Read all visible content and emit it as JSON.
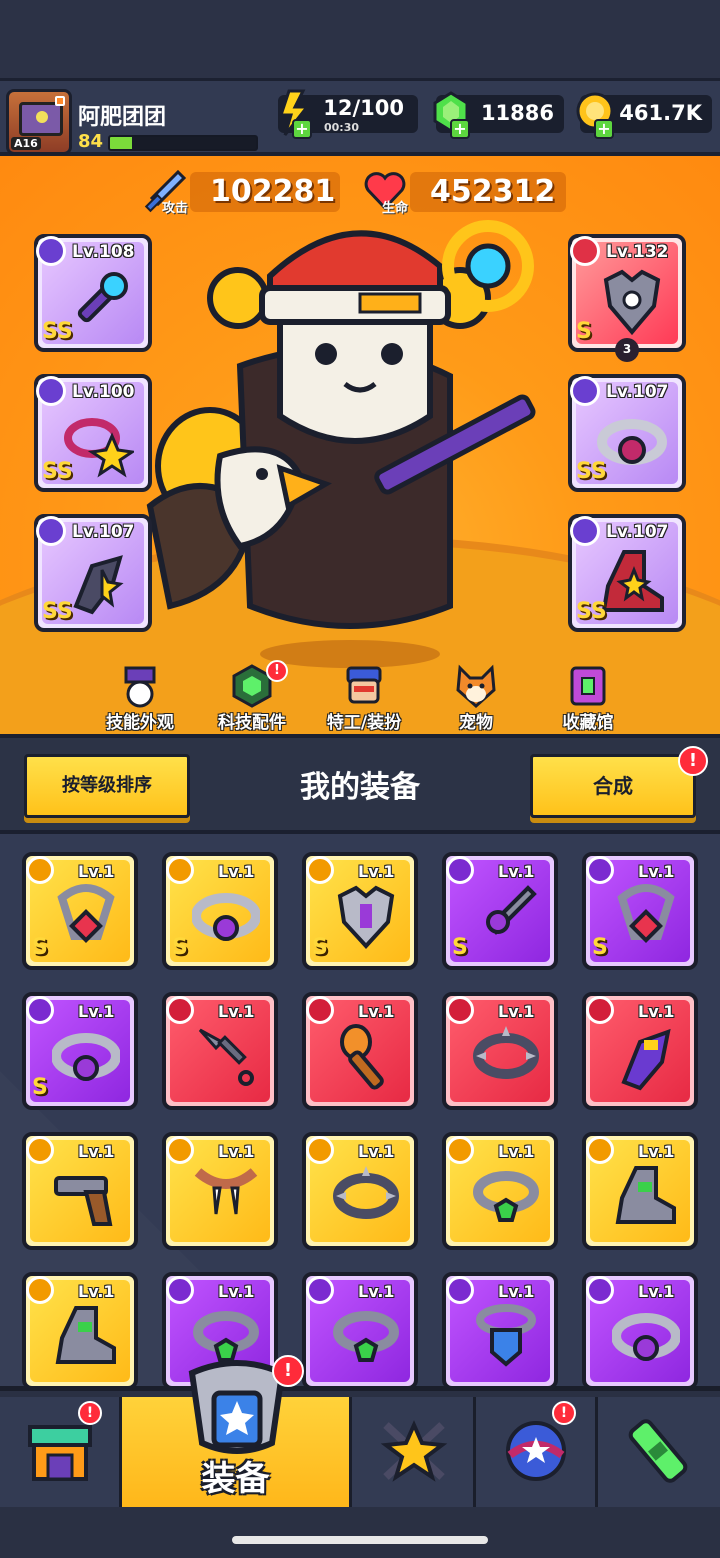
{
  "player": {
    "name": "阿肥团团",
    "level": "84",
    "avatar_tag": "A16",
    "xp_progress": 0.15
  },
  "resources": {
    "energy": {
      "value": "12/100",
      "timer": "00:30"
    },
    "gems": {
      "value": "11886"
    },
    "gold": {
      "value": "461.7K"
    }
  },
  "stats": {
    "attack": {
      "label": "攻击",
      "value": "102281"
    },
    "hp": {
      "label": "生命",
      "value": "452312"
    }
  },
  "equipped": {
    "left": [
      {
        "level": "Lv.108",
        "grade": "SS",
        "rarity": "purple",
        "icon": "staff-icon",
        "type_icon": "weapon-type-icon"
      },
      {
        "level": "Lv.100",
        "grade": "SS",
        "rarity": "purple",
        "icon": "star-necklace-icon",
        "type_icon": "necklace-type-icon"
      },
      {
        "level": "Lv.107",
        "grade": "SS",
        "rarity": "purple",
        "icon": "gauntlet-icon",
        "type_icon": "glove-type-icon"
      }
    ],
    "right": [
      {
        "level": "Lv.132",
        "grade": "S",
        "rarity": "red",
        "icon": "armor-icon",
        "type_icon": "armor-type-icon",
        "stars": "3"
      },
      {
        "level": "Lv.107",
        "grade": "SS",
        "rarity": "purple",
        "icon": "belt-icon",
        "type_icon": "belt-type-icon"
      },
      {
        "level": "Lv.107",
        "grade": "SS",
        "rarity": "purple",
        "icon": "boots-icon",
        "type_icon": "boots-type-icon"
      }
    ]
  },
  "menu": [
    {
      "label": "技能外观",
      "icon": "skill-skin-icon",
      "badge": ""
    },
    {
      "label": "科技配件",
      "icon": "tech-part-icon",
      "badge": "!"
    },
    {
      "label": "特工/装扮",
      "icon": "agent-icon",
      "badge": ""
    },
    {
      "label": "宠物",
      "icon": "pet-icon",
      "badge": ""
    },
    {
      "label": "收藏馆",
      "icon": "collection-icon",
      "badge": ""
    }
  ],
  "equipment_panel": {
    "sort_button": "按等级排序",
    "title": "我的装备",
    "synth_button": "合成",
    "synth_badge": "!"
  },
  "inventory": [
    {
      "level": "Lv.1",
      "rarity": "yellow",
      "grade": "S",
      "icon": "necklace-icon"
    },
    {
      "level": "Lv.1",
      "rarity": "yellow",
      "grade": "S",
      "icon": "belt-icon"
    },
    {
      "level": "Lv.1",
      "rarity": "yellow",
      "grade": "S",
      "icon": "armor-icon"
    },
    {
      "level": "Lv.1",
      "rarity": "purple",
      "grade": "S",
      "icon": "sword-icon"
    },
    {
      "level": "Lv.1",
      "rarity": "purple",
      "grade": "S",
      "icon": "necklace-icon"
    },
    {
      "level": "Lv.1",
      "rarity": "purple",
      "grade": "S",
      "icon": "belt-icon"
    },
    {
      "level": "Lv.1",
      "rarity": "red",
      "grade": "",
      "icon": "kunai-icon"
    },
    {
      "level": "Lv.1",
      "rarity": "red",
      "grade": "",
      "icon": "torch-icon"
    },
    {
      "level": "Lv.1",
      "rarity": "red",
      "grade": "",
      "icon": "spiked-collar-icon"
    },
    {
      "level": "Lv.1",
      "rarity": "red",
      "grade": "",
      "icon": "gauntlet-icon"
    },
    {
      "level": "Lv.1",
      "rarity": "yellow",
      "grade": "",
      "icon": "revolver-icon"
    },
    {
      "level": "Lv.1",
      "rarity": "yellow",
      "grade": "",
      "icon": "fang-necklace-icon"
    },
    {
      "level": "Lv.1",
      "rarity": "yellow",
      "grade": "",
      "icon": "spiked-collar-icon"
    },
    {
      "level": "Lv.1",
      "rarity": "yellow",
      "grade": "",
      "icon": "gem-ring-icon"
    },
    {
      "level": "Lv.1",
      "rarity": "yellow",
      "grade": "",
      "icon": "boots-icon"
    },
    {
      "level": "Lv.1",
      "rarity": "yellow",
      "grade": "",
      "icon": "boots-icon"
    },
    {
      "level": "Lv.1",
      "rarity": "purple",
      "grade": "",
      "icon": "gem-ring-icon"
    },
    {
      "level": "Lv.1",
      "rarity": "purple",
      "grade": "",
      "icon": "gem-ring-icon"
    },
    {
      "level": "Lv.1",
      "rarity": "purple",
      "grade": "",
      "icon": "shield-necklace-icon"
    },
    {
      "level": "Lv.1",
      "rarity": "purple",
      "grade": "",
      "icon": "belt-icon"
    }
  ],
  "bottom_nav": [
    {
      "label": "",
      "icon": "shop-icon",
      "badge": "!"
    },
    {
      "label": "装备",
      "icon": "equipment-icon",
      "badge": "!",
      "active": true
    },
    {
      "label": "",
      "icon": "skills-star-icon",
      "badge": ""
    },
    {
      "label": "",
      "icon": "world-icon",
      "badge": "!"
    },
    {
      "label": "",
      "icon": "lab-tube-icon",
      "badge": ""
    }
  ],
  "colors": {
    "accent": "#ffc21a",
    "background": "#2b3144",
    "stage": "#ff9b18",
    "alert": "#ff2b3a"
  }
}
